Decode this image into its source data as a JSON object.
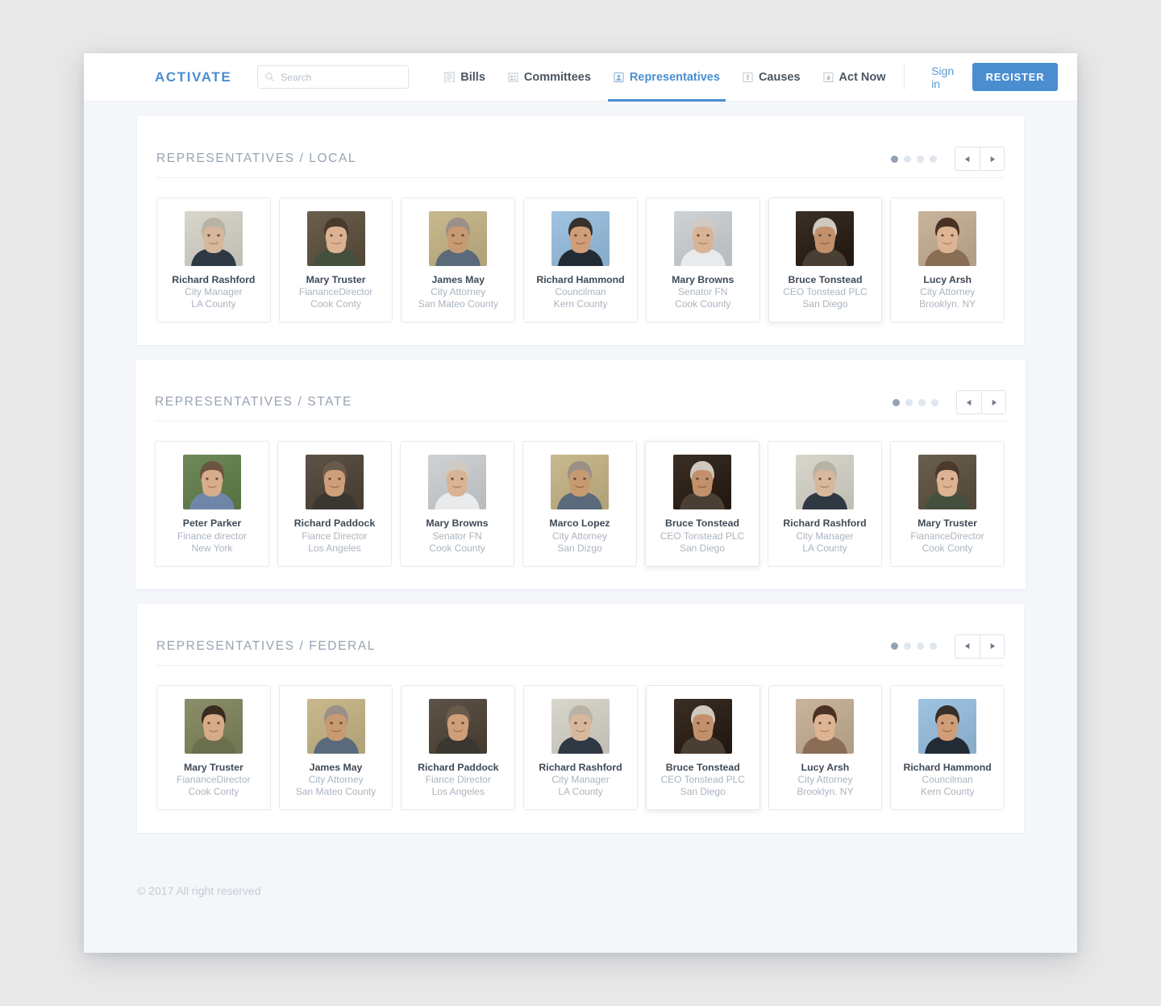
{
  "brand": "ACTIVATE",
  "search": {
    "placeholder": "Search",
    "value": ""
  },
  "nav": {
    "items": [
      {
        "label": "Bills",
        "icon": "document-icon",
        "active": false
      },
      {
        "label": "Committees",
        "icon": "group-icon",
        "active": false
      },
      {
        "label": "Representatives",
        "icon": "person-badge-icon",
        "active": true
      },
      {
        "label": "Causes",
        "icon": "megaphone-icon",
        "active": false
      },
      {
        "label": "Act Now",
        "icon": "hand-icon",
        "active": false
      }
    ],
    "signin_label": "Sign in",
    "register_label": "REGISTER"
  },
  "colors": {
    "accent": "#4a8ed0",
    "page_bg": "#f4f7fa",
    "panel_bg": "#ffffff",
    "title": "#97a3b2",
    "muted": "#aab4bf"
  },
  "sections": [
    {
      "title": "REPRESENTATIVES / LOCAL",
      "dots": 4,
      "active_dot": 0,
      "prev_label": "Previous",
      "next_label": "Next",
      "cards": [
        {
          "name": "Richard Rashford",
          "role": "City Manager",
          "location": "LA County",
          "photo": "m1"
        },
        {
          "name": "Mary Truster",
          "role": "FiananceDirector",
          "location": "Cook Conty",
          "photo": "f1"
        },
        {
          "name": "James May",
          "role": "City Attorney",
          "location": "San Mateo County",
          "photo": "m2"
        },
        {
          "name": "Richard Hammond",
          "role": "Councilman",
          "location": "Kern County",
          "photo": "m3"
        },
        {
          "name": "Mary Browns",
          "role": "Senator FN",
          "location": "Cook County",
          "photo": "f2"
        },
        {
          "name": "Bruce Tonstead",
          "role": "CEO Tonstead PLC",
          "location": "San Diego",
          "photo": "m4"
        },
        {
          "name": "Lucy Arsh",
          "role": "City Attorney",
          "location": "Brooklyn. NY",
          "photo": "f3"
        }
      ]
    },
    {
      "title": "REPRESENTATIVES / STATE",
      "dots": 4,
      "active_dot": 0,
      "prev_label": "Previous",
      "next_label": "Next",
      "cards": [
        {
          "name": "Peter Parker",
          "role": "Finance director",
          "location": "New York",
          "photo": "m5"
        },
        {
          "name": "Richard Paddock",
          "role": "Fiance Director",
          "location": "Los Angeles",
          "photo": "m6"
        },
        {
          "name": "Mary Browns",
          "role": "Senator FN",
          "location": "Cook County",
          "photo": "f2"
        },
        {
          "name": "Marco Lopez",
          "role": "City Attorney",
          "location": "San Dizgo",
          "photo": "m2"
        },
        {
          "name": "Bruce Tonstead",
          "role": "CEO Tonstead PLC",
          "location": "San Diego",
          "photo": "m4"
        },
        {
          "name": "Richard Rashford",
          "role": "City Manager",
          "location": "LA County",
          "photo": "m1"
        },
        {
          "name": "Mary Truster",
          "role": "FiananceDirector",
          "location": "Cook Conty",
          "photo": "f1"
        }
      ]
    },
    {
      "title": "REPRESENTATIVES / FEDERAL",
      "dots": 4,
      "active_dot": 0,
      "prev_label": "Previous",
      "next_label": "Next",
      "cards": [
        {
          "name": "Mary Truster",
          "role": "FiananceDirector",
          "location": "Cook Conty",
          "photo": "f4"
        },
        {
          "name": "James May",
          "role": "City Attorney",
          "location": "San Mateo County",
          "photo": "m2"
        },
        {
          "name": "Richard Paddock",
          "role": "Fiance Director",
          "location": "Los Angeles",
          "photo": "m6"
        },
        {
          "name": "Richard Rashford",
          "role": "City Manager",
          "location": "LA County",
          "photo": "m1"
        },
        {
          "name": "Bruce Tonstead",
          "role": "CEO Tonstead PLC",
          "location": "San Diego",
          "photo": "m4"
        },
        {
          "name": "Lucy Arsh",
          "role": "City Attorney",
          "location": "Brooklyn. NY",
          "photo": "f3"
        },
        {
          "name": "Richard Hammond",
          "role": "Councilman",
          "location": "Kern County",
          "photo": "m3"
        }
      ]
    }
  ],
  "footer": {
    "copyright": "© 2017 All right reserved"
  }
}
